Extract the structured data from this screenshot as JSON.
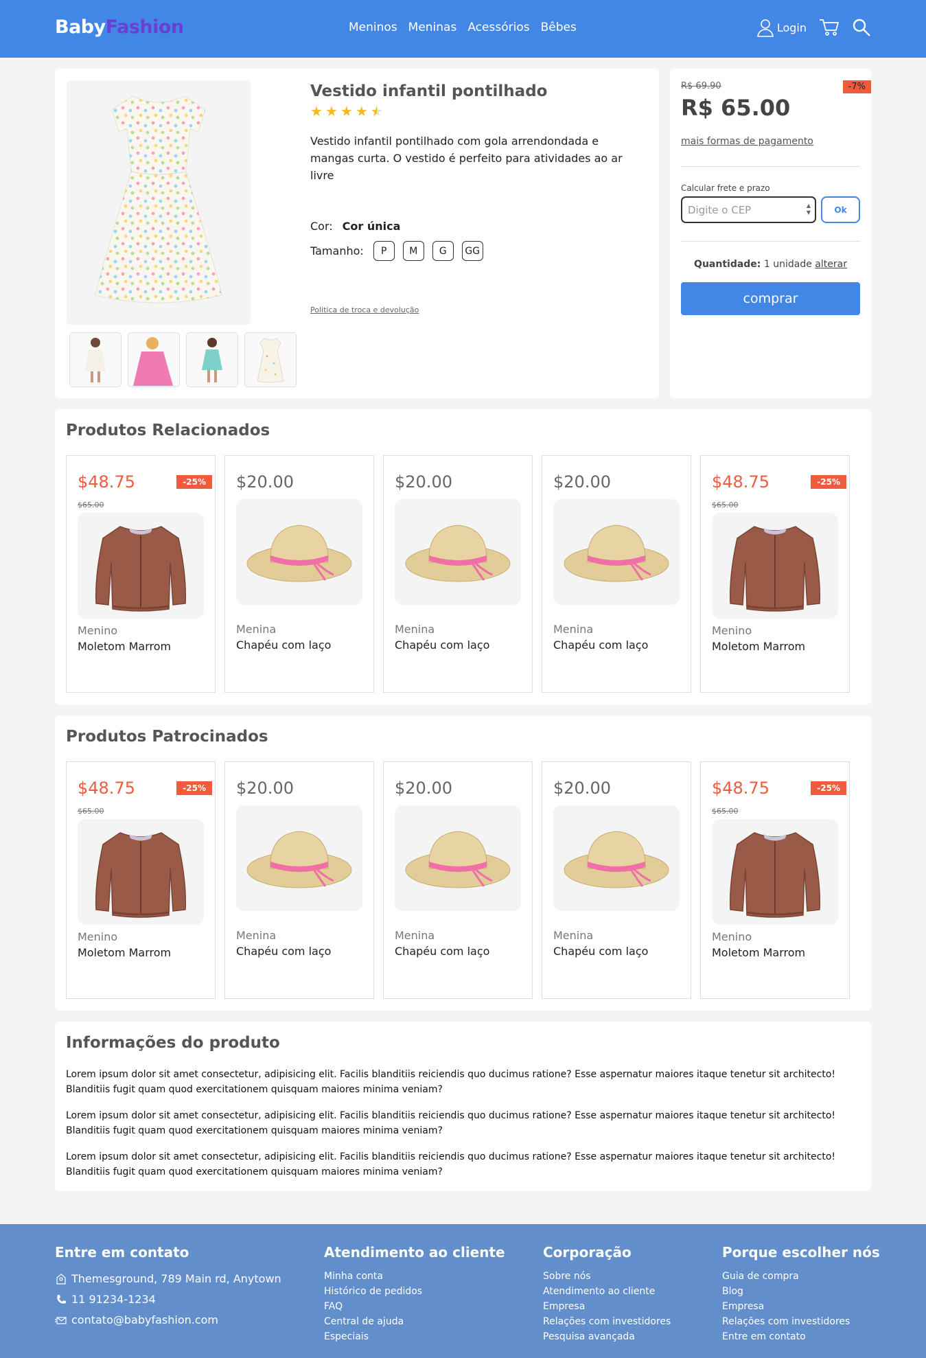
{
  "header": {
    "logo_part1": "Baby",
    "logo_part2": "Fashion",
    "nav": [
      "Meninos",
      "Meninas",
      "Acessórios",
      "Bêbes"
    ],
    "login_label": "Login"
  },
  "product": {
    "title": "Vestido infantil pontilhado",
    "rating": 4.5,
    "description": "Vestido infantil pontilhado com gola arrendondada e mangas curta. O vestido é perfeito para atividades ao ar livre",
    "color_label": "Cor:",
    "color_value": "Cor única",
    "size_label": "Tamanho:",
    "sizes": [
      "P",
      "M",
      "G",
      "GG"
    ],
    "policy_link": "Politica de troca e devolução"
  },
  "buy": {
    "old_price": "R$ 69.90",
    "discount": "-7%",
    "price": "R$ 65.00",
    "more_payment": "mais formas de pagamento",
    "shipping_label": "Calcular frete e prazo",
    "cep_placeholder": "Digite o CEP",
    "ok_label": "Ok",
    "qty_label": "Quantidade:",
    "qty_value": "1 unidade",
    "qty_change": "alterar",
    "buy_label": "comprar"
  },
  "related": {
    "title": "Produtos Relacionados",
    "cards": [
      {
        "price": "$48.75",
        "old": "$65.00",
        "disc": "-25%",
        "cat": "Menino",
        "name": "Moletom Marrom",
        "type": "sweater"
      },
      {
        "price": "$20.00",
        "old": "",
        "disc": "",
        "cat": "Menina",
        "name": "Chapéu com laço",
        "type": "hat"
      },
      {
        "price": "$20.00",
        "old": "",
        "disc": "",
        "cat": "Menina",
        "name": "Chapéu com laço",
        "type": "hat"
      },
      {
        "price": "$20.00",
        "old": "",
        "disc": "",
        "cat": "Menina",
        "name": "Chapéu com laço",
        "type": "hat"
      },
      {
        "price": "$48.75",
        "old": "$65.00",
        "disc": "-25%",
        "cat": "Menino",
        "name": "Moletom Marrom",
        "type": "sweater"
      }
    ]
  },
  "sponsored": {
    "title": "Produtos Patrocinados",
    "cards": [
      {
        "price": "$48.75",
        "old": "$65.00",
        "disc": "-25%",
        "cat": "Menino",
        "name": "Moletom Marrom",
        "type": "sweater"
      },
      {
        "price": "$20.00",
        "old": "",
        "disc": "",
        "cat": "Menina",
        "name": "Chapéu com laço",
        "type": "hat"
      },
      {
        "price": "$20.00",
        "old": "",
        "disc": "",
        "cat": "Menina",
        "name": "Chapéu com laço",
        "type": "hat"
      },
      {
        "price": "$20.00",
        "old": "",
        "disc": "",
        "cat": "Menina",
        "name": "Chapéu com laço",
        "type": "hat"
      },
      {
        "price": "$48.75",
        "old": "$65.00",
        "disc": "-25%",
        "cat": "Menino",
        "name": "Moletom Marrom",
        "type": "sweater"
      }
    ]
  },
  "info": {
    "title": "Informações do produto",
    "paragraphs": [
      "Lorem ipsum dolor sit amet consectetur, adipisicing elit. Facilis blanditiis reiciendis quo ducimus ratione? Esse aspernatur maiores itaque tenetur sit architecto! Blanditiis fugit quam quod exercitationem quisquam maiores minima veniam?",
      "Lorem ipsum dolor sit amet consectetur, adipisicing elit. Facilis blanditiis reiciendis quo ducimus ratione? Esse aspernatur maiores itaque tenetur sit architecto! Blanditiis fugit quam quod exercitationem quisquam maiores minima veniam?",
      "Lorem ipsum dolor sit amet consectetur, adipisicing elit. Facilis blanditiis reiciendis quo ducimus ratione? Esse aspernatur maiores itaque tenetur sit architecto! Blanditiis fugit quam quod exercitationem quisquam maiores minima veniam?"
    ]
  },
  "footer": {
    "contact": {
      "title": "Entre em contato",
      "address": "Themesground, 789 Main rd, Anytown",
      "phone": "11 91234-1234",
      "email": "contato@babyfashion.com"
    },
    "support": {
      "title": "Atendimento ao cliente",
      "links": [
        "Minha conta",
        "Histórico de pedidos",
        "FAQ",
        "Central de ajuda",
        "Especiais"
      ]
    },
    "corp": {
      "title": "Corporação",
      "links": [
        "Sobre nós",
        "Atendimento ao cliente",
        "Empresa",
        "Relações com investidores",
        "Pesquisa avançada"
      ]
    },
    "why": {
      "title": "Porque escolher nós",
      "links": [
        "Guia de compra",
        "Blog",
        "Empresa",
        "Relações com investidores",
        "Entre em contato"
      ]
    }
  },
  "colors": {
    "primary": "#4287e6",
    "sale": "#f05a3e",
    "footer": "#628fcc",
    "star": "#f5b921"
  }
}
